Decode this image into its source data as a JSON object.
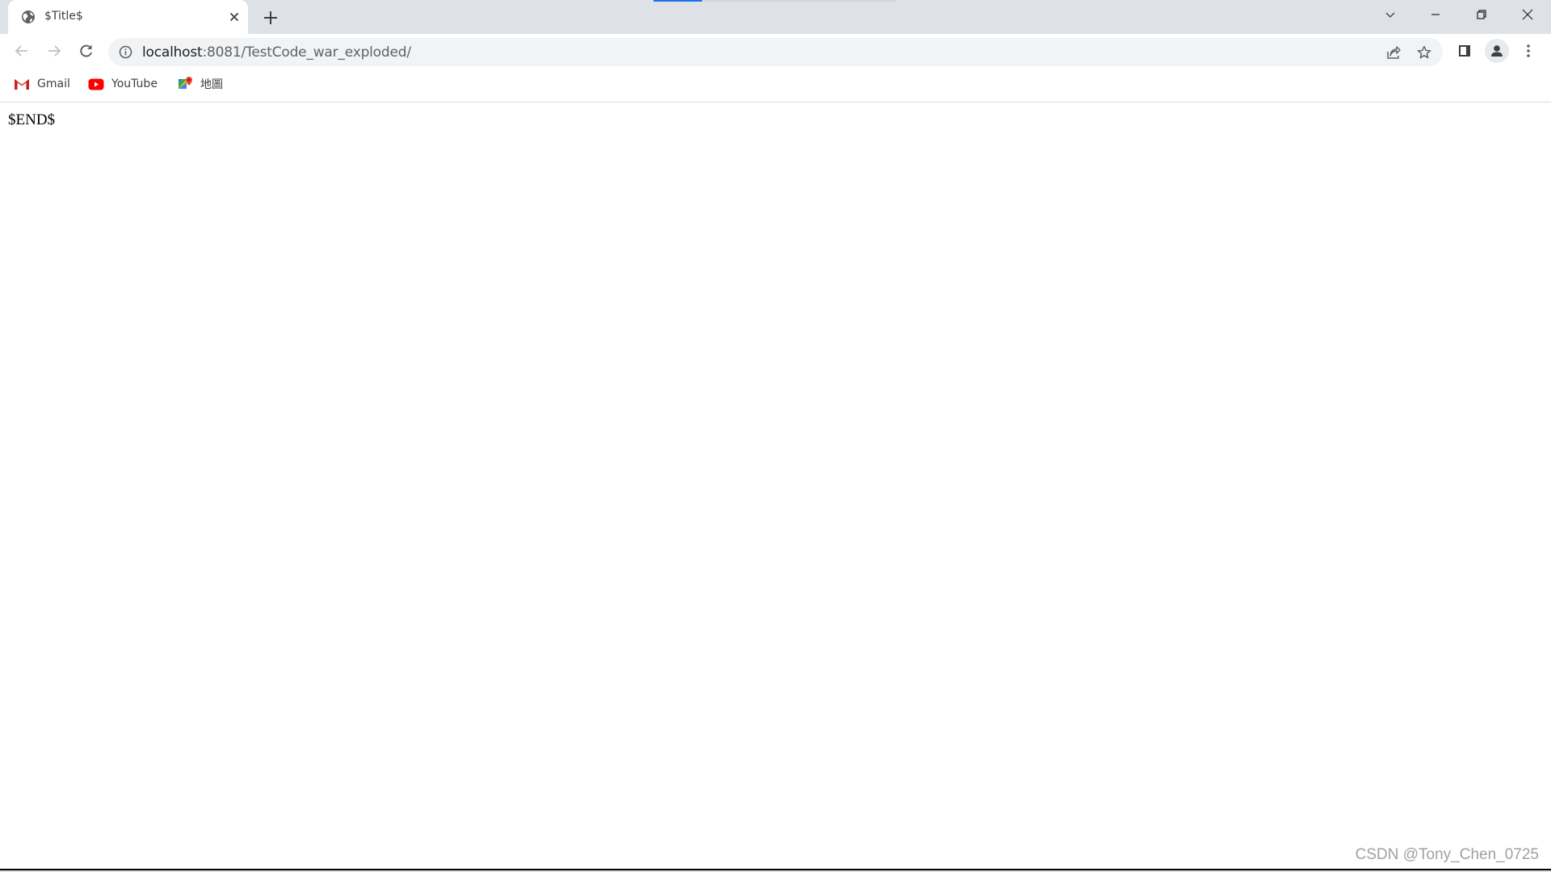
{
  "browser": {
    "tab": {
      "title": "$Title$",
      "favicon": "globe-icon",
      "close_icon": "close-icon"
    },
    "new_tab_icon": "plus-icon",
    "window_controls": {
      "tab_search": "chevron-down-icon",
      "minimize": "minimize-icon",
      "restore": "restore-icon",
      "close": "close-icon"
    },
    "loading_progress": 0.2,
    "toolbar": {
      "back": "arrow-left-icon",
      "forward": "arrow-right-icon",
      "reload": "reload-icon",
      "site_info": "info-icon",
      "url_host": "localhost",
      "url_rest": ":8081/TestCode_war_exploded/",
      "share": "share-icon",
      "bookmark": "star-icon",
      "side_panel": "side-panel-icon",
      "profile": "avatar-icon",
      "menu": "kebab-menu-icon"
    },
    "bookmarks": [
      {
        "label": "Gmail",
        "icon": "gmail-icon"
      },
      {
        "label": "YouTube",
        "icon": "youtube-icon"
      },
      {
        "label": "地圖",
        "icon": "maps-icon"
      }
    ]
  },
  "page": {
    "body_text": "$END$"
  },
  "watermark": "CSDN @Tony_Chen_0725"
}
